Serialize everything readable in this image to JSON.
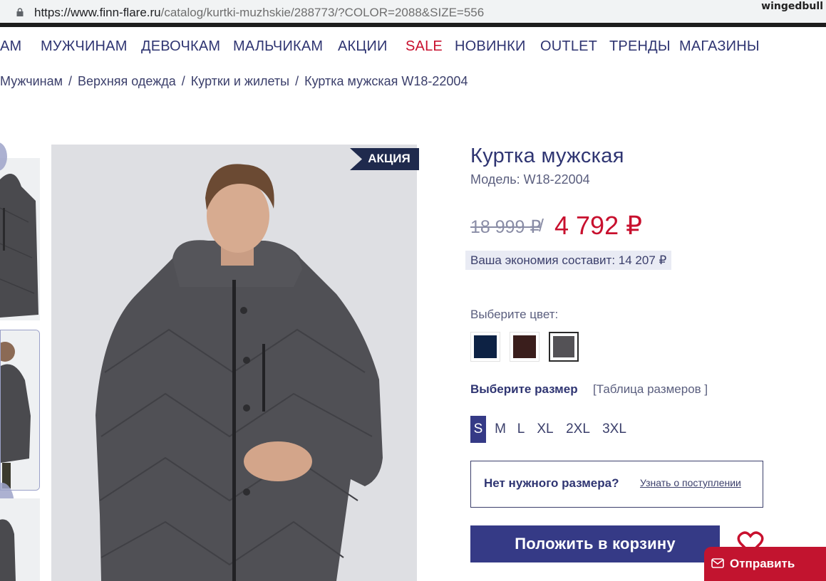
{
  "browser": {
    "url_host": "https://www.finn-flare.ru",
    "url_path": "/catalog/kurtki-muzhskie/288773/?COLOR=2088&SIZE=556",
    "watermark_user": "wingedbull"
  },
  "nav": {
    "items": [
      "АМ",
      "МУЖЧИНАМ",
      "ДЕВОЧКАМ",
      "МАЛЬЧИКАМ",
      "АКЦИИ",
      "SALE",
      "НОВИНКИ",
      "OUTLET",
      "ТРЕНДЫ",
      "МАГАЗИНЫ"
    ]
  },
  "breadcrumb": {
    "items": [
      "Мужчинам",
      "Верхняя одежда",
      "Куртки и жилеты",
      "Куртка мужская W18-22004"
    ],
    "separator": "/"
  },
  "gallery": {
    "badge": "АКЦИЯ"
  },
  "product": {
    "title": "Куртка мужская",
    "model": "Модель: W18-22004",
    "old_price": "18 999 ₽",
    "price_separator": "/",
    "new_price": "4 792 ₽",
    "savings": "Ваша экономия составит: 14 207 ₽",
    "color_label": "Выберите цвет:",
    "colors": [
      {
        "name": "navy",
        "hex": "#0d2244",
        "selected": false
      },
      {
        "name": "brown",
        "hex": "#3a1e1c",
        "selected": false
      },
      {
        "name": "grey",
        "hex": "#545256",
        "selected": true
      }
    ],
    "size_label": "Выберите размер",
    "size_table_link": "[Таблица размеров ]",
    "sizes": [
      "S",
      "M",
      "L",
      "XL",
      "2XL",
      "3XL"
    ],
    "selected_size": "S",
    "no_size_question": "Нет нужного размера?",
    "no_size_link": "Узнать о поступлении",
    "add_to_cart": "Положить в корзину"
  },
  "overlay": {
    "label": "Отправить"
  },
  "colors": {
    "brand": "#353a86",
    "sale": "#c8102e",
    "text": "#2f3572"
  }
}
